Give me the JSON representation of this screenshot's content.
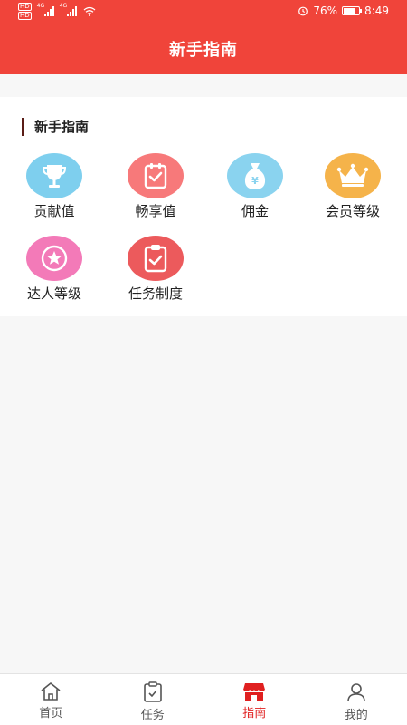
{
  "status_bar": {
    "net_badge": "HD",
    "signal_1": "4G",
    "signal_2": "4G",
    "battery_level": 0.76,
    "battery_text": "76%",
    "time": "8:49"
  },
  "header": {
    "title": "新手指南"
  },
  "section": {
    "title": "新手指南"
  },
  "guide_items": [
    {
      "label": "贡献值",
      "icon": "trophy-icon",
      "color": "#7ecfee"
    },
    {
      "label": "畅享值",
      "icon": "clipboard-check-icon",
      "color": "#f7797a"
    },
    {
      "label": "佣金",
      "icon": "money-bag-icon",
      "color": "#8ad3ef"
    },
    {
      "label": "会员等级",
      "icon": "crown-icon",
      "color": "#f5b34a"
    },
    {
      "label": "达人等级",
      "icon": "star-badge-icon",
      "color": "#f37ab8"
    },
    {
      "label": "任务制度",
      "icon": "task-clipboard-icon",
      "color": "#ec5a5c"
    }
  ],
  "bottom_nav": [
    {
      "label": "首页",
      "icon": "home-icon",
      "active": false
    },
    {
      "label": "任务",
      "icon": "task-icon",
      "active": false
    },
    {
      "label": "指南",
      "icon": "store-icon",
      "active": true
    },
    {
      "label": "我的",
      "icon": "user-icon",
      "active": false
    }
  ],
  "colors": {
    "brand": "#f0443a",
    "active_nav": "#e02020"
  }
}
